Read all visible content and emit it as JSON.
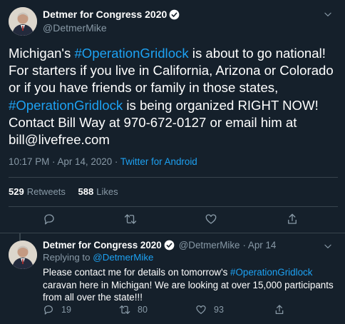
{
  "main_tweet": {
    "display_name": "Detmer for Congress 2020",
    "handle": "@DetmerMike",
    "text_parts": [
      {
        "text": "Michigan's ",
        "tag": false
      },
      {
        "text": "#OperationGridlock",
        "tag": true
      },
      {
        "text": " is about to go national! For starters if you live in California, Arizona or Colorado or if you have friends or family in those states, ",
        "tag": false
      },
      {
        "text": "#OperationGridlock",
        "tag": true
      },
      {
        "text": " is being organized RIGHT NOW! Contact Bill Way at 970-672-0127 or email him at bill@livefree.com",
        "tag": false
      }
    ],
    "timestamp": "10:17 PM · Apr 14, 2020",
    "separator": " · ",
    "source": "Twitter for Android",
    "retweets_count": "529",
    "retweets_label": "Retweets",
    "likes_count": "588",
    "likes_label": "Likes"
  },
  "reply_tweet": {
    "display_name": "Detmer for Congress 2020",
    "handle": "@DetmerMike",
    "date": "· Apr 14",
    "replying_prefix": "Replying to ",
    "replying_to": "@DetmerMike",
    "text_parts": [
      {
        "text": "Please contact me for details on tomorrow's ",
        "tag": false
      },
      {
        "text": "#OperationGridlock",
        "tag": true
      },
      {
        "text": " caravan here in Michigan!  We are looking at over 15,000 participants from all over the state!!!",
        "tag": false
      }
    ],
    "reply_count": "19",
    "retweet_count": "80",
    "like_count": "93"
  },
  "colors": {
    "background": "#15202b",
    "accent": "#1da1f2",
    "secondary_text": "#8899a6",
    "divider": "#38444d"
  },
  "icons": [
    "verified-badge-icon",
    "caret-down-icon",
    "reply-icon",
    "retweet-icon",
    "like-icon",
    "share-icon"
  ]
}
